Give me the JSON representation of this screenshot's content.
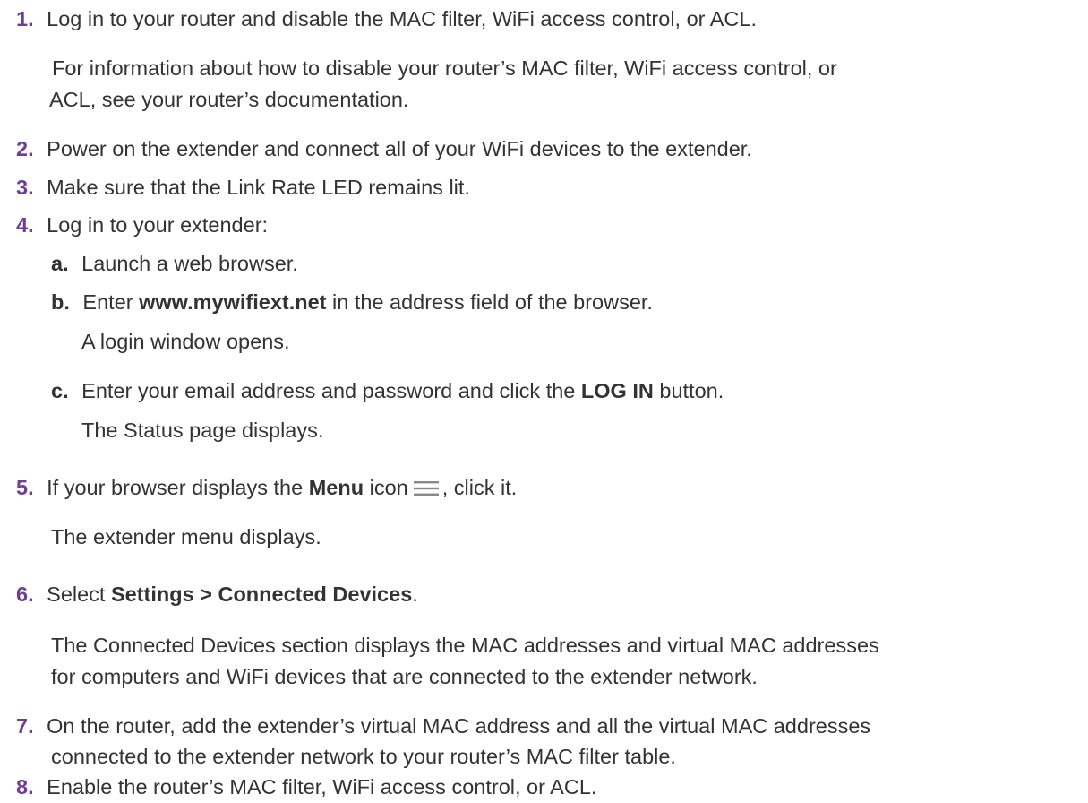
{
  "steps": [
    {
      "num": "1.",
      "text": "Log in to your router and disable the MAC filter, WiFi access control, or ACL."
    },
    {
      "num": "2.",
      "text": "Power on the extender and connect all of your WiFi devices to the extender."
    },
    {
      "num": "3.",
      "text": "Make sure that the Link Rate LED remains lit."
    },
    {
      "num": "4.",
      "text": "Log in to your extender:"
    },
    {
      "num": "5.",
      "text_before": "If your browser displays the ",
      "bold": "Menu",
      "text_after": " icon",
      "text_end": ", click it."
    },
    {
      "num": "6.",
      "text_before": "Select ",
      "bold": "Settings > Connected Devices",
      "text_after": "."
    },
    {
      "num": "7.",
      "text": "On the router, add the extender’s virtual MAC address and all the virtual MAC addresses"
    },
    {
      "num": "8.",
      "text": "Enable the router’s MAC filter, WiFi access control, or ACL."
    }
  ],
  "step1_note": {
    "line1": "For information about how to disable your router’s MAC filter, WiFi access control, or",
    "line2": "ACL, see your router’s documentation."
  },
  "substeps": [
    {
      "letter": "a.",
      "text": "Launch a web browser."
    },
    {
      "letter": "b.",
      "text_before": "Enter ",
      "bold": "www.mywifiext.net",
      "text_after": " in the address field of the browser.",
      "result": "A login window opens."
    },
    {
      "letter": "c.",
      "text_before": "Enter your email address and password and click the ",
      "bold": "LOG IN",
      "text_after": " button.",
      "result": "The Status page displays."
    }
  ],
  "step5_result": "The extender menu displays.",
  "step6_result": {
    "line1": "The Connected Devices section displays the MAC addresses and virtual MAC addresses",
    "line2": "for computers and WiFi devices that are connected to the extender network."
  },
  "step7_line2": "connected to the extender network to your router’s MAC filter table.",
  "colors": {
    "step_number": "#6f3d96",
    "text": "#333333",
    "menu_icon": "#888888"
  },
  "icons": {
    "menu": "hamburger-menu-icon"
  }
}
